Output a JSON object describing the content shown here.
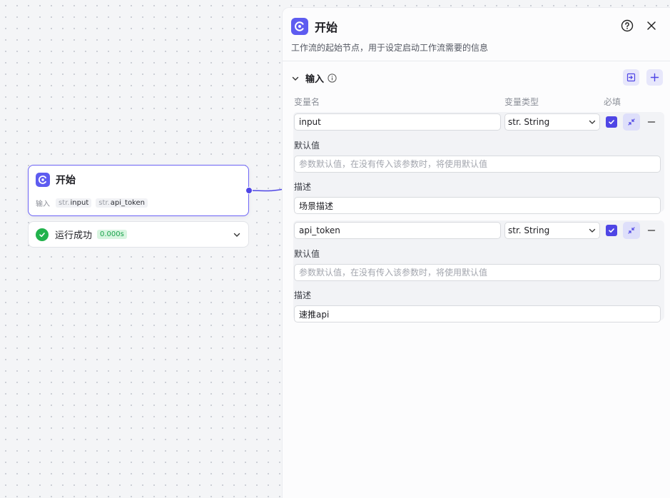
{
  "node": {
    "title": "开始",
    "inputs_label": "输入",
    "inputs": [
      {
        "type": "str.",
        "name": "input"
      },
      {
        "type": "str.",
        "name": "api_token"
      }
    ]
  },
  "run": {
    "label": "运行成功",
    "time": "0.000s"
  },
  "panel": {
    "title": "开始",
    "description": "工作流的起始节点，用于设定启动工作流需要的信息",
    "section_title": "输入",
    "columns": {
      "name": "变量名",
      "type": "变量类型",
      "required": "必填"
    },
    "default_label": "默认值",
    "desc_label": "描述",
    "variables": [
      {
        "name": "input",
        "type": "str. String",
        "required": true,
        "default_value": "",
        "default_placeholder": "参数默认值，在没有传入该参数时，将使用默认值",
        "description": "场景描述"
      },
      {
        "name": "api_token",
        "type": "str. String",
        "required": true,
        "default_value": "",
        "default_placeholder": "参数默认值，在没有传入该参数时，将使用默认值",
        "description": "速推api"
      }
    ]
  },
  "colors": {
    "accent": "#4f46e5",
    "node_border": "#6c63f6",
    "success": "#22b24c"
  }
}
